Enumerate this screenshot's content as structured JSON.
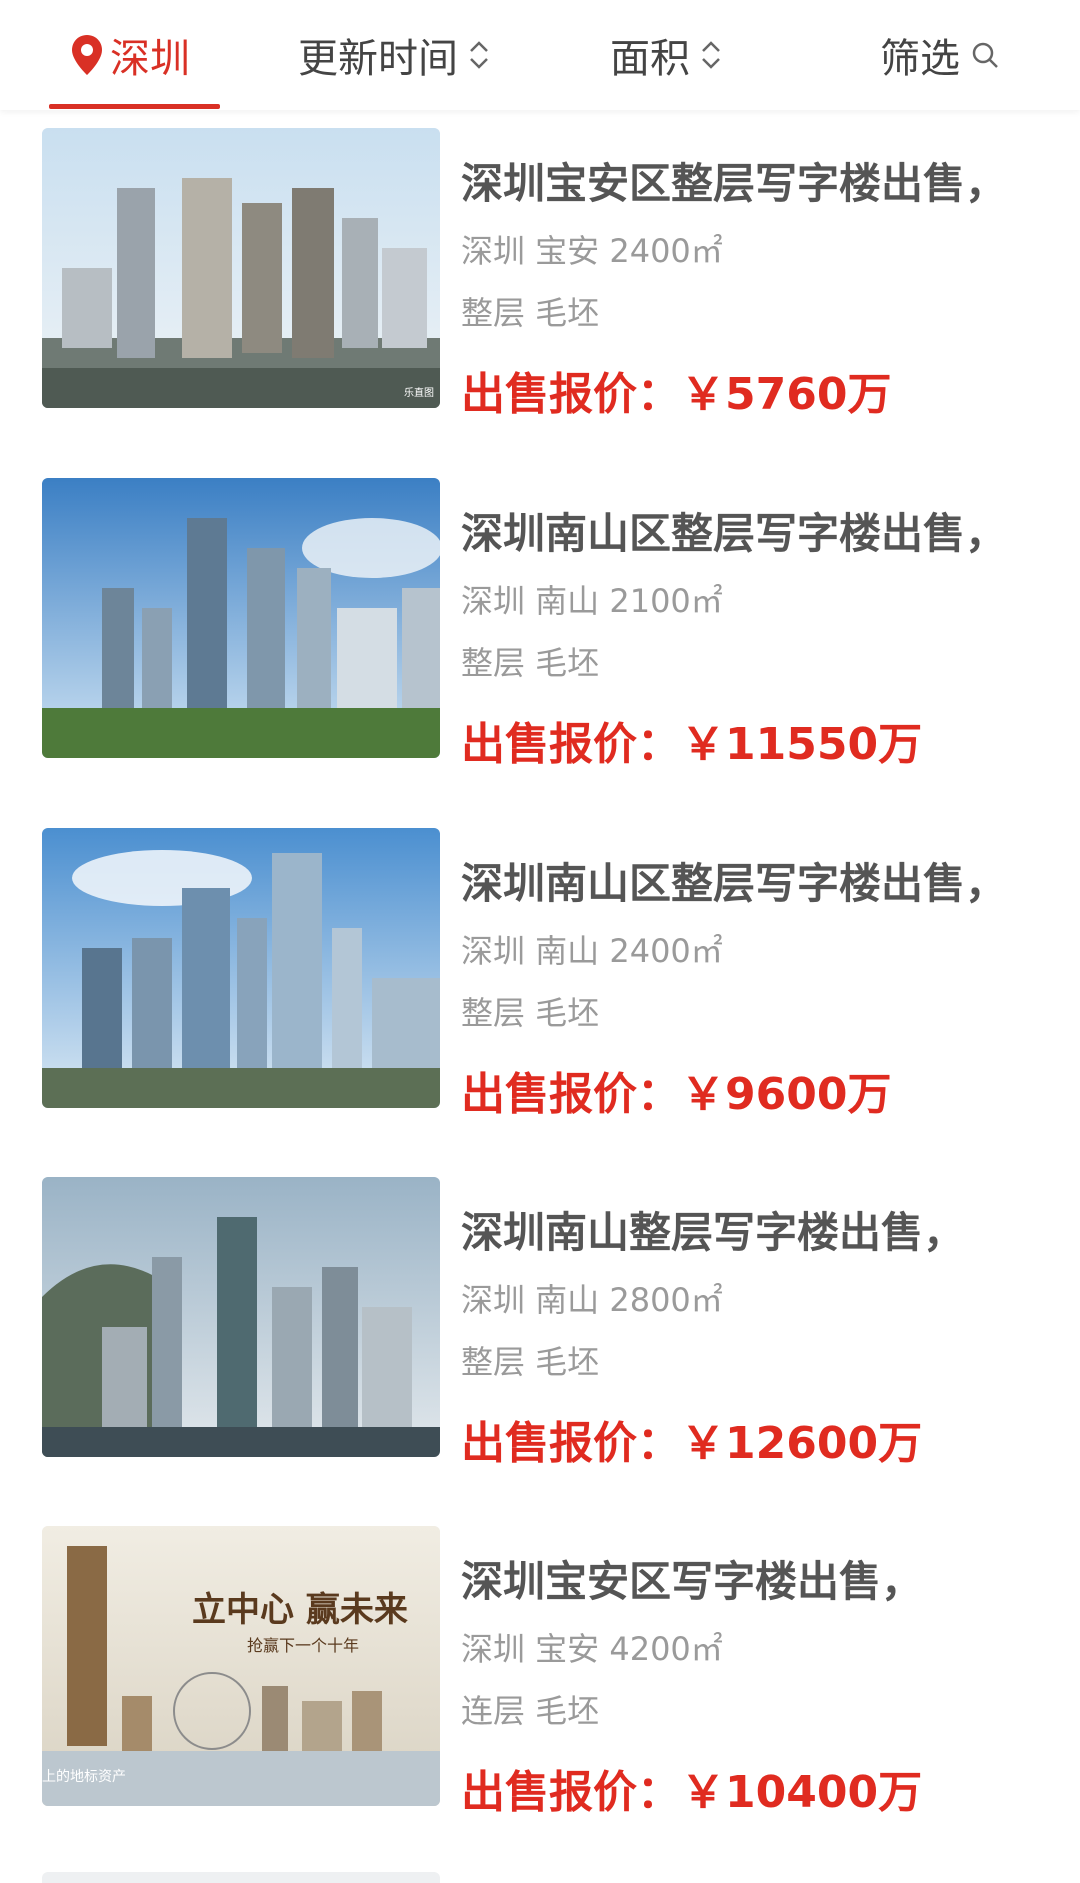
{
  "filter_bar": {
    "city": "深圳",
    "update_time": "更新时间",
    "area": "面积",
    "filter": "筛选"
  },
  "accent_color": "#e02b20",
  "listings": [
    {
      "title": "深圳宝安区整层写字楼出售，",
      "meta": "深圳 宝安 2400㎡",
      "tags": "整层 毛坯",
      "price_label": "出售报价：",
      "price_value": "￥5760万",
      "image_text": "乐直图"
    },
    {
      "title": "深圳南山区整层写字楼出售，",
      "meta": "深圳 南山 2100㎡",
      "tags": "整层 毛坯",
      "price_label": "出售报价：",
      "price_value": "￥11550万"
    },
    {
      "title": "深圳南山区整层写字楼出售，",
      "meta": "深圳 南山 2400㎡",
      "tags": "整层 毛坯",
      "price_label": "出售报价：",
      "price_value": "￥9600万"
    },
    {
      "title": "深圳南山整层写字楼出售，",
      "meta": "深圳 南山 2800㎡",
      "tags": "整层 毛坯",
      "price_label": "出售报价：",
      "price_value": "￥12600万"
    },
    {
      "title": "深圳宝安区写字楼出售，",
      "meta": "深圳 宝安 4200㎡",
      "tags": "连层 毛坯",
      "price_label": "出售报价：",
      "price_value": "￥10400万",
      "image_headline": "立中心 赢未来",
      "image_subline": "抢赢下一个十年",
      "image_caption": "上的地标资产"
    }
  ]
}
